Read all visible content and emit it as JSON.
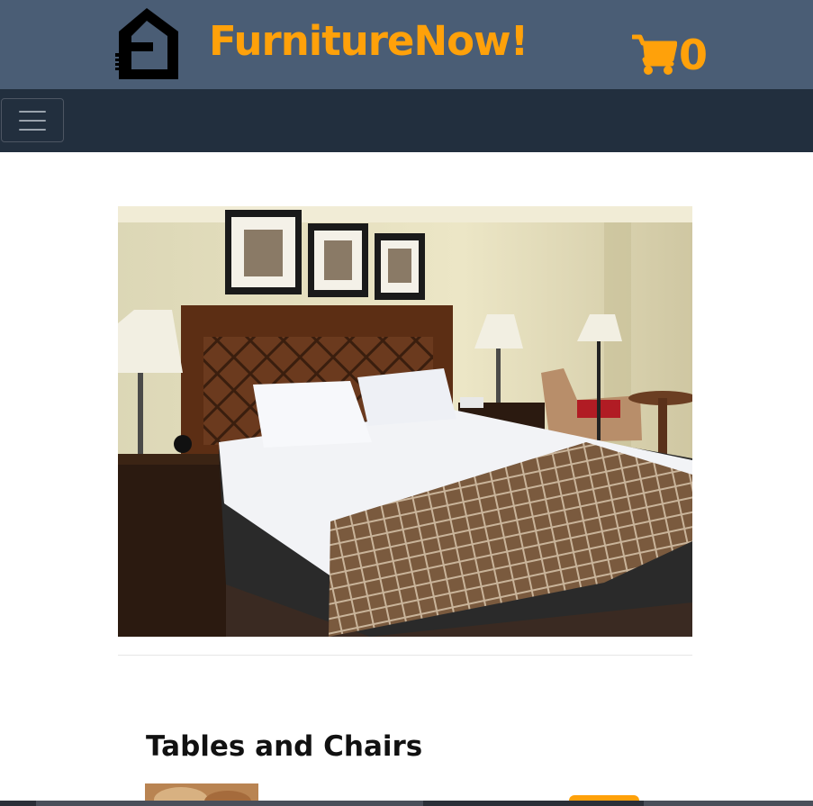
{
  "header": {
    "brand": "FurnitureNow!",
    "cart_count": "0",
    "logo_icon": "house-logo-icon",
    "cart_icon": "shopping-cart-icon",
    "accent_color": "#ffa10a",
    "background_color": "#4a5d75"
  },
  "navbar": {
    "toggler_icon": "hamburger-menu-icon",
    "background_color": "#222f3e"
  },
  "main": {
    "hero_image": "bedroom-photo",
    "section_title": "Tables and Chairs"
  }
}
